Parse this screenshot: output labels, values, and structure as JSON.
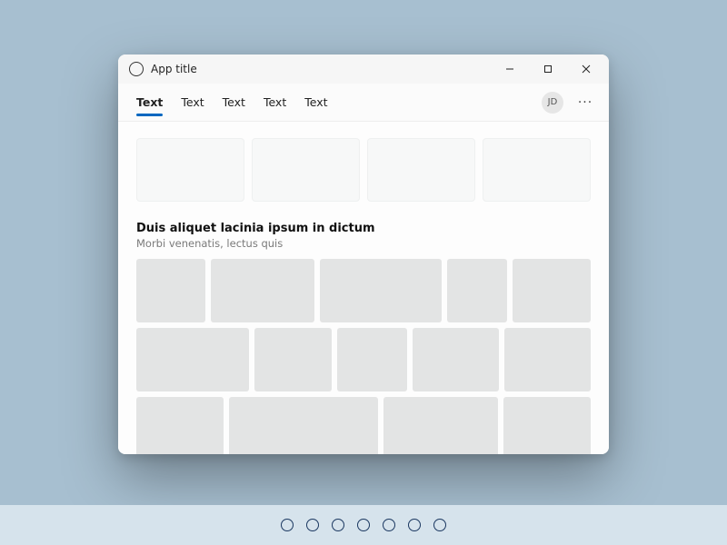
{
  "app_title": "App title",
  "avatar_initials": "JD",
  "tabs": [
    "Text",
    "Text",
    "Text",
    "Text",
    "Text"
  ],
  "section": {
    "title": "Duis aliquet lacinia ipsum in dictum",
    "subtitle": "Morbi venenatis, lectus quis"
  },
  "colors": {
    "accent": "#0067c0",
    "desktop_bg": "#a7bfd0",
    "footer_bg": "#d6e3ec"
  },
  "footer_circle_count": 7,
  "hero_card_count": 4,
  "masonry": [
    [
      80,
      120,
      140,
      70,
      90
    ],
    [
      130,
      90,
      80,
      100,
      100
    ],
    [
      100,
      170,
      130,
      100
    ]
  ]
}
